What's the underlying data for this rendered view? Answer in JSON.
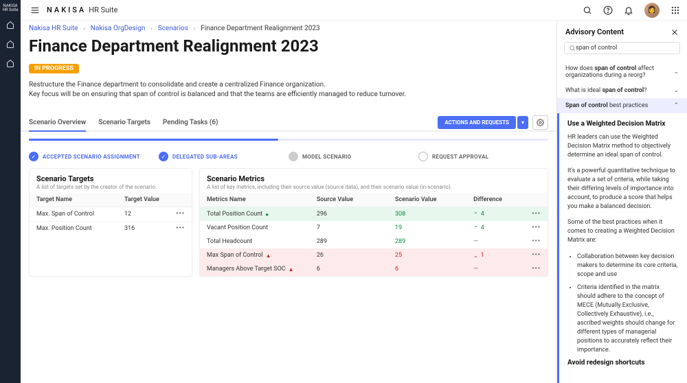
{
  "brand": {
    "name": "NAKISA",
    "suffix": "HR Suite"
  },
  "breadcrumbs": {
    "items": [
      "Nakisa HR Suite",
      "Nakisa OrgDesign",
      "Scenarios"
    ],
    "current": "Finance Department Realignment 2023"
  },
  "page": {
    "title": "Finance Department Realignment 2023",
    "status": "IN PROGRESS",
    "description_line1": "Restructure the Finance department to consolidate and create a centralized Finance organization.",
    "description_line2": "Key focus will be on ensuring that span of control is balanced and that the teams are efficiently managed to reduce turnover."
  },
  "tabs": {
    "items": [
      "Scenario Overview",
      "Scenario Targets",
      "Pending Tasks (6)"
    ],
    "active": 0,
    "actions_btn": "ACTIONS AND REQUESTS"
  },
  "stepper": {
    "steps": [
      {
        "label": "ACCEPTED SCENARIO ASSIGNMENT",
        "state": "done"
      },
      {
        "label": "DELEGATED SUB-AREAS",
        "state": "done"
      },
      {
        "label": "MODEL SCENARIO",
        "state": "pending"
      },
      {
        "label": "REQUEST APPROVAL",
        "state": "empty"
      }
    ]
  },
  "targets_card": {
    "title": "Scenario Targets",
    "subtitle": "A list of targets set by the creator of the scenario.",
    "headers": [
      "Target Name",
      "Target Value"
    ],
    "rows": [
      {
        "name": "Max. Span of Control",
        "value": "12"
      },
      {
        "name": "Max. Position Count",
        "value": "316"
      }
    ]
  },
  "metrics_card": {
    "title": "Scenario Metrics",
    "subtitle": "A list of key metrics, including their source value (source data), and their scenario value (in-scenario).",
    "headers": [
      "Metrics Name",
      "Source Value",
      "Scenario Value",
      "Difference"
    ],
    "rows": [
      {
        "name": "Total Position Count",
        "indicator": "green",
        "source": "296",
        "scenario": "308",
        "scenario_tone": "pos",
        "diff_dir": "up",
        "diff": "4",
        "tone": "good"
      },
      {
        "name": "Vacant Position Count",
        "source": "7",
        "scenario": "19",
        "scenario_tone": "pos",
        "diff_dir": "up",
        "diff": "4",
        "tone": ""
      },
      {
        "name": "Total Headcount",
        "source": "289",
        "scenario": "289",
        "scenario_tone": "pos",
        "diff": "—",
        "tone": ""
      },
      {
        "name": "Max Span of Control",
        "indicator": "red",
        "source": "26",
        "scenario": "25",
        "scenario_tone": "neg",
        "diff_dir": "down",
        "diff": "1",
        "tone": "bad"
      },
      {
        "name": "Managers Above Target SOC",
        "indicator": "red",
        "source": "6",
        "scenario": "6",
        "scenario_tone": "neg",
        "diff": "—",
        "tone": "bad"
      }
    ]
  },
  "advisory": {
    "title": "Advisory Content",
    "search_value": "span of control",
    "q1_pre": "How does ",
    "q1_strong": "span of control",
    "q1_post": " affect organizations during a reorg?",
    "q2_pre": "What is ideal ",
    "q2_strong": "span of control",
    "q2_post": "?",
    "hl_pre": "Span of control",
    "hl_post": " best practices",
    "section_title": "Use a Weighted Decision Matrix",
    "p1": "HR leaders can use the Weighted Decision Matrix method to objectively determine an ideal span of control.",
    "p2": "It's a powerful quantitative technique to evaluate a set of criteria, while taking their differing levels of importance into account, to produce a score that helps you make a balanced decision.",
    "p3": "Some of the best practices when it comes to creating a Weighted Decision Matrix are:",
    "bullets": [
      "Collaboration between key decision makers to determine its core criteria, scope and use",
      "Criteria identified in the matrix should adhere to the concept of MECE (Mutually Exclusive, Collectively Exhaustive), i.e., ascribed weights should change for different types of managerial positions to accurately reflect their importance."
    ],
    "section2_title": "Avoid redesign shortcuts"
  }
}
